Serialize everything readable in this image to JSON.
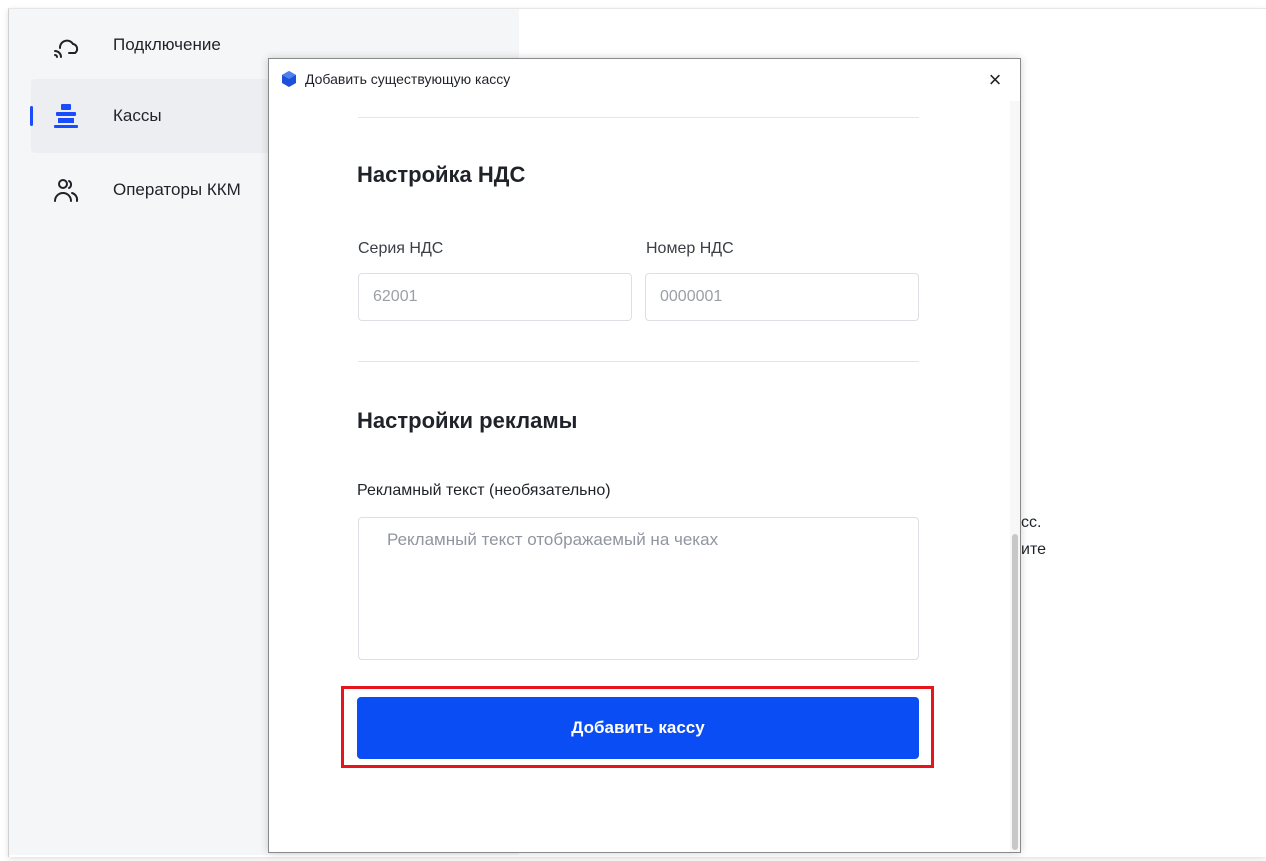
{
  "sidebar": {
    "items": [
      {
        "label": "Подключение",
        "icon": "cloud-connection-icon"
      },
      {
        "label": "Кассы",
        "icon": "cash-register-icon",
        "active": true
      },
      {
        "label": "Операторы ККМ",
        "icon": "operators-icon"
      }
    ]
  },
  "background": {
    "text_line_1": "сс.",
    "text_line_2": "ите"
  },
  "dialog": {
    "title": "Добавить существующую кассу",
    "close_label": "×",
    "vat": {
      "heading": "Настройка НДС",
      "series_label": "Серия НДС",
      "series_placeholder": "62001",
      "number_label": "Номер НДС",
      "number_placeholder": "0000001"
    },
    "ads": {
      "heading": "Настройки рекламы",
      "text_label": "Рекламный текст (необязательно)",
      "text_placeholder": "Рекламный текст отображаемый на чеках"
    },
    "submit_label": "Добавить кассу"
  },
  "colors": {
    "accent": "#0b4df5",
    "highlight": "#e8141b",
    "active_indicator": "#1a4cff"
  }
}
